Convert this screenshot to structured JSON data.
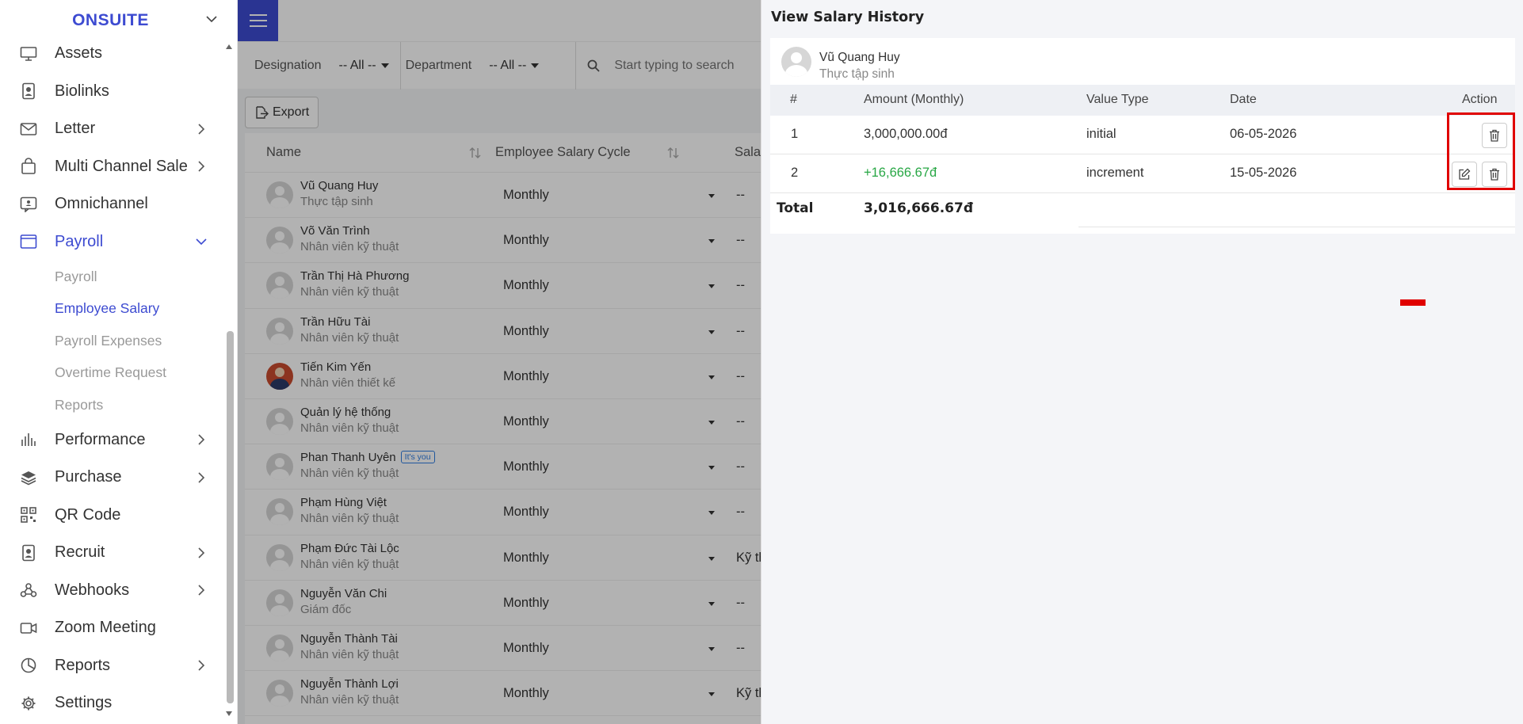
{
  "sidebar": {
    "brand": "ONSUITE",
    "items": [
      {
        "label": "Assets",
        "icon": "monitor-icon",
        "has_chevron": false
      },
      {
        "label": "Biolinks",
        "icon": "id-badge-icon",
        "has_chevron": false
      },
      {
        "label": "Letter",
        "icon": "envelope-icon",
        "has_chevron": true
      },
      {
        "label": "Multi Channel Sale",
        "icon": "shopping-bag-icon",
        "has_chevron": true
      },
      {
        "label": "Omnichannel",
        "icon": "chat-icon",
        "has_chevron": false
      },
      {
        "label": "Payroll",
        "icon": "wallet-icon",
        "has_chevron": true,
        "active": true
      }
    ],
    "payroll_sub": [
      {
        "label": "Payroll"
      },
      {
        "label": "Employee Salary",
        "active": true
      },
      {
        "label": "Payroll Expenses"
      },
      {
        "label": "Overtime Request"
      },
      {
        "label": "Reports"
      }
    ],
    "items_after": [
      {
        "label": "Performance",
        "icon": "bar-chart-icon",
        "has_chevron": true
      },
      {
        "label": "Purchase",
        "icon": "layers-icon",
        "has_chevron": true
      },
      {
        "label": "QR Code",
        "icon": "qr-code-icon",
        "has_chevron": false
      },
      {
        "label": "Recruit",
        "icon": "id-card-icon",
        "has_chevron": true
      },
      {
        "label": "Webhooks",
        "icon": "webhook-icon",
        "has_chevron": true
      },
      {
        "label": "Zoom Meeting",
        "icon": "video-icon",
        "has_chevron": false
      },
      {
        "label": "Reports",
        "icon": "pie-chart-icon",
        "has_chevron": true
      },
      {
        "label": "Settings",
        "icon": "gear-icon",
        "has_chevron": false
      }
    ]
  },
  "filters": {
    "designation_label": "Designation",
    "designation_value": "-- All --",
    "department_label": "Department",
    "department_value": "-- All --",
    "search_placeholder": "Start typing to search"
  },
  "toolbar": {
    "export_label": "Export"
  },
  "employee_table": {
    "columns": {
      "name": "Name",
      "cycle": "Employee Salary Cycle",
      "salary": "Sala"
    },
    "rows": [
      {
        "name": "Vũ Quang Huy",
        "role": "Thực tập sinh",
        "cycle": "Monthly",
        "salary": "--"
      },
      {
        "name": "Võ Văn Trình",
        "role": "Nhân viên kỹ thuật",
        "cycle": "Monthly",
        "salary": "--"
      },
      {
        "name": "Trần Thị Hà Phương",
        "role": "Nhân viên kỹ thuật",
        "cycle": "Monthly",
        "salary": "--"
      },
      {
        "name": "Trần Hữu Tài",
        "role": "Nhân viên kỹ thuật",
        "cycle": "Monthly",
        "salary": "--"
      },
      {
        "name": "Tiến Kim Yến",
        "role": "Nhân viên thiết kế",
        "cycle": "Monthly",
        "salary": "--",
        "photo": true
      },
      {
        "name": "Quản lý hệ thống",
        "role": "Nhân viên kỹ thuật",
        "cycle": "Monthly",
        "salary": "--"
      },
      {
        "name": "Phan Thanh Uyên",
        "role": "Nhân viên kỹ thuật",
        "cycle": "Monthly",
        "salary": "--",
        "badge": "It's you"
      },
      {
        "name": "Phạm Hùng Việt",
        "role": "Nhân viên kỹ thuật",
        "cycle": "Monthly",
        "salary": "--"
      },
      {
        "name": "Phạm Đức Tài Lộc",
        "role": "Nhân viên kỹ thuật",
        "cycle": "Monthly",
        "salary": "Kỹ th"
      },
      {
        "name": "Nguyễn Văn Chi",
        "role": "Giám đốc",
        "cycle": "Monthly",
        "salary": "--"
      },
      {
        "name": "Nguyễn Thành Tài",
        "role": "Nhân viên kỹ thuật",
        "cycle": "Monthly",
        "salary": "--"
      },
      {
        "name": "Nguyễn Thành Lợi",
        "role": "Nhân viên kỹ thuật",
        "cycle": "Monthly",
        "salary": "Kỹ th"
      }
    ]
  },
  "panel": {
    "title": "View Salary History",
    "employee_name": "Vũ Quang Huy",
    "employee_role": "Thực tập sinh",
    "columns": {
      "num": "#",
      "amount": "Amount (Monthly)",
      "type": "Value Type",
      "date": "Date",
      "action": "Action"
    },
    "rows": [
      {
        "num": "1",
        "amount": "3,000,000.00đ",
        "type": "initial",
        "date": "06-05-2026"
      },
      {
        "num": "2",
        "amount": "+16,666.67đ",
        "type": "increment",
        "date": "15-05-2026"
      }
    ],
    "total_label": "Total",
    "total_value": "3,016,666.67đ"
  },
  "colors": {
    "accent": "#3d4bd1",
    "positive": "#28a745",
    "highlight": "#e00000"
  }
}
